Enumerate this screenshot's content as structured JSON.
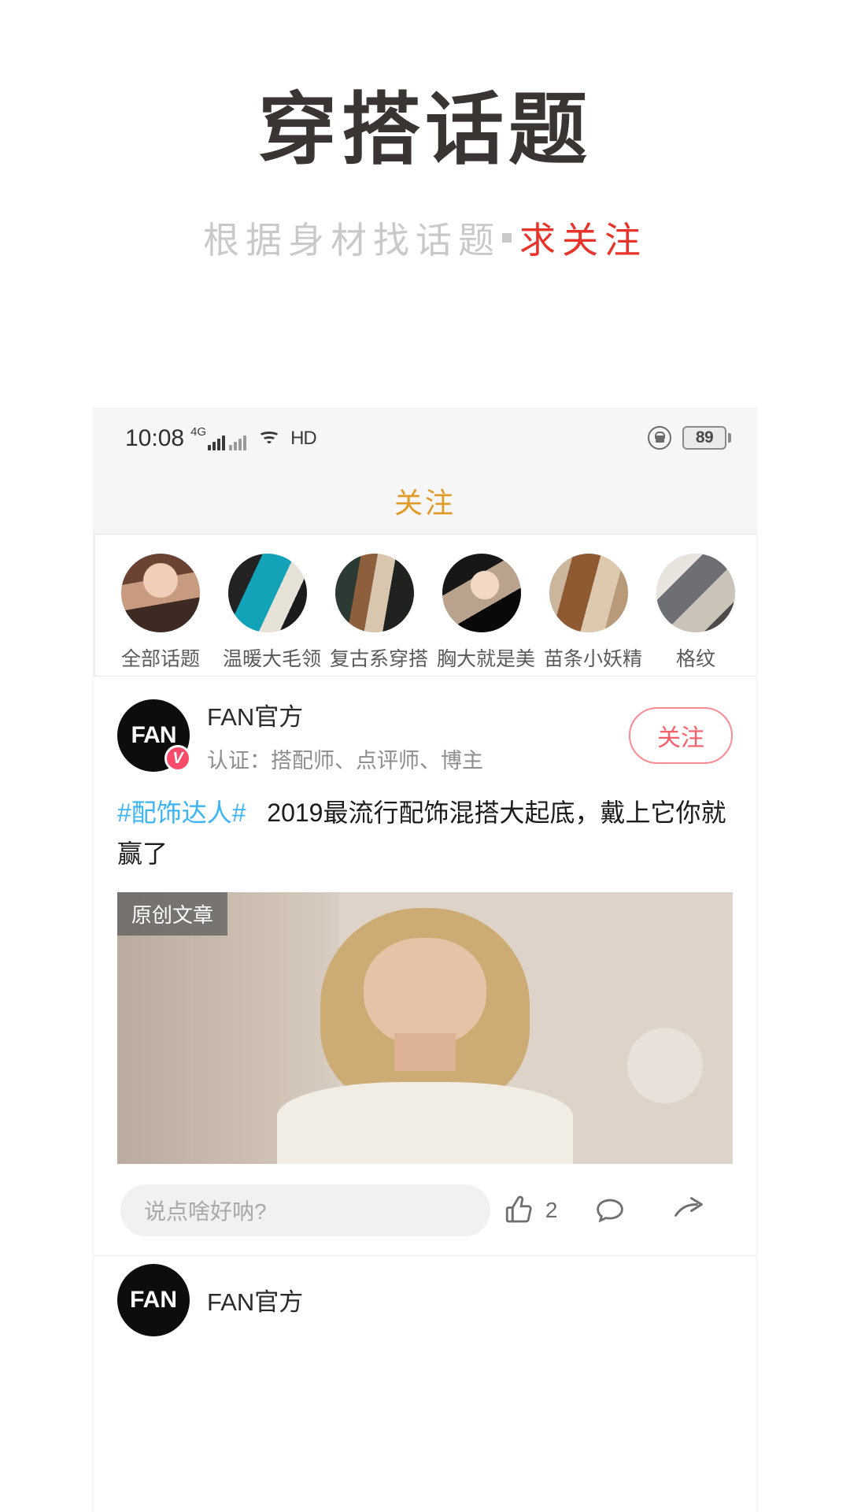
{
  "poster": {
    "title": "穿搭话题",
    "subtitle_gray": "根据身材找话题",
    "subtitle_accent": "求关注",
    "title_color": "#3a3432",
    "accent_color": "#e8342a",
    "sub_color": "#c9c9c9"
  },
  "status_bar": {
    "time": "10:08",
    "network": "4G",
    "hd": "HD",
    "battery_level": "89",
    "icons": [
      "signal-icon",
      "wifi-icon",
      "hd-icon",
      "rotation-lock-icon",
      "battery-icon"
    ]
  },
  "tabs": {
    "active": "关注"
  },
  "topics": {
    "items": [
      {
        "label": "全部话题"
      },
      {
        "label": "温暖大毛领"
      },
      {
        "label": "复古系穿搭"
      },
      {
        "label": "胸大就是美"
      },
      {
        "label": "苗条小妖精"
      },
      {
        "label": "格纹"
      }
    ]
  },
  "post": {
    "avatar_text": "FAN",
    "verify_badge": "V",
    "author": "FAN官方",
    "certification": "认证：搭配师、点评师、博主",
    "follow_label": "关注",
    "hashtag": "#配饰达人#",
    "body": "2019最流行配饰混搭大起底，戴上它你就赢了",
    "image_badge": "原创文章",
    "comment_placeholder": "说点啥好呐?",
    "like_count": "2",
    "accent_follow_color": "#f76069",
    "tag_color": "#3ab4f2"
  },
  "next_post": {
    "avatar_text": "FAN",
    "author": "FAN官方"
  }
}
